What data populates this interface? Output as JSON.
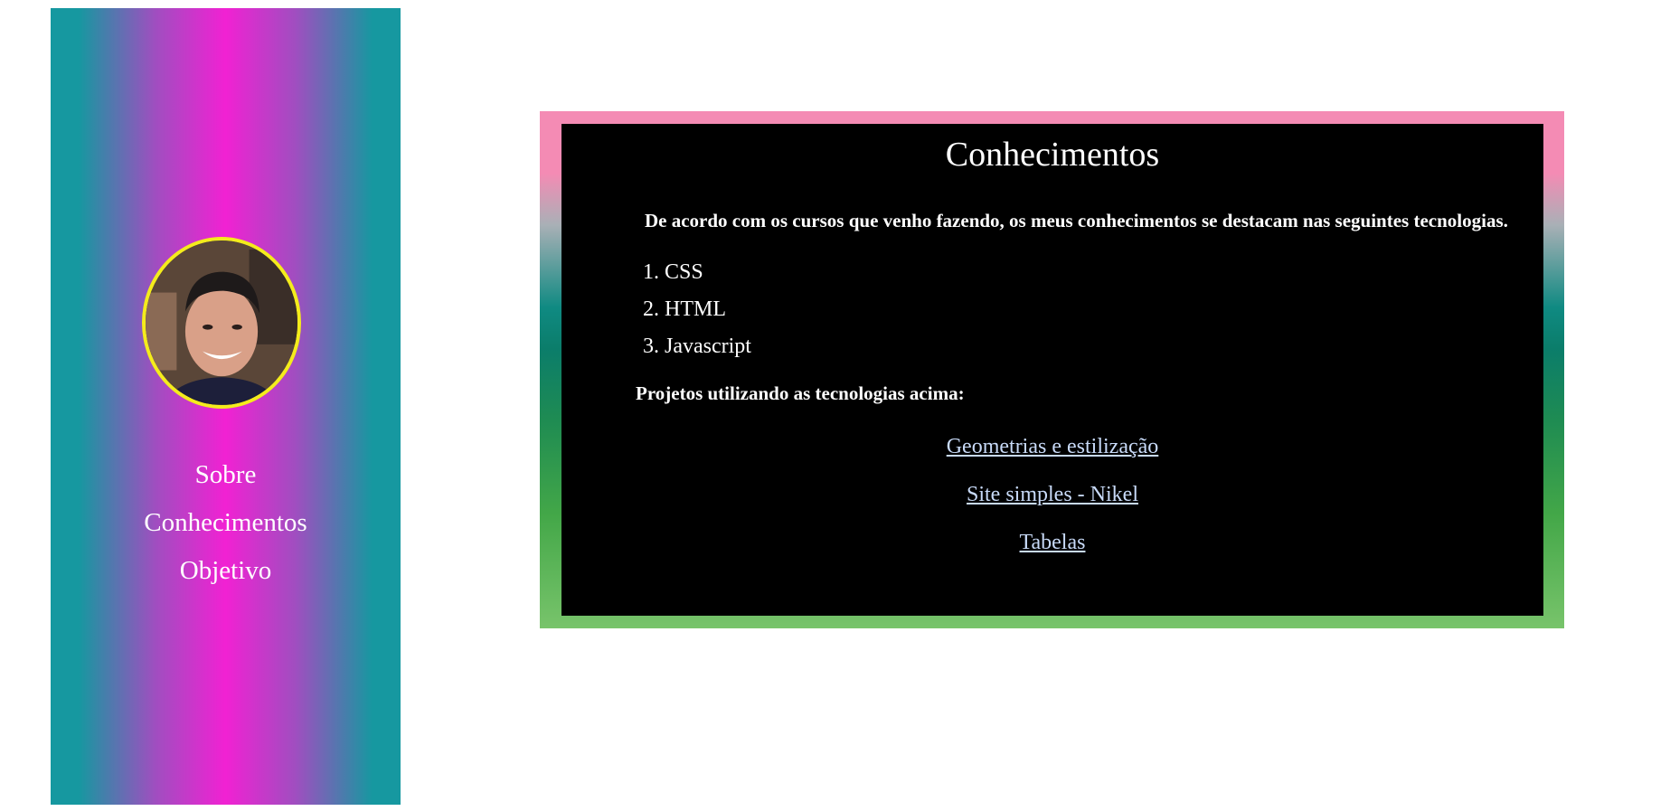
{
  "sidebar": {
    "nav": [
      {
        "label": "Sobre"
      },
      {
        "label": "Conhecimentos"
      },
      {
        "label": "Objetivo"
      }
    ],
    "colors": {
      "gradient_edge": "#1698a0",
      "gradient_center": "#f121d3",
      "avatar_border": "#f4ec1c"
    }
  },
  "main": {
    "title": "Conhecimentos",
    "intro": "De acordo com os cursos que venho fazendo, os meus conhecimentos se destacam nas seguintes tecnologias.",
    "technologies": [
      "CSS",
      "HTML",
      "Javascript"
    ],
    "projects_label": "Projetos utilizando as tecnologias acima:",
    "projects": [
      {
        "label": "Geometrias e estilização"
      },
      {
        "label": "Site simples - Nikel"
      },
      {
        "label": "Tabelas"
      }
    ],
    "colors": {
      "frame_top": "#f48bb4",
      "frame_middle": "#0f8a82",
      "frame_bottom": "#78c46b",
      "panel_background": "#000000",
      "link_color": "#c8daf8"
    }
  }
}
